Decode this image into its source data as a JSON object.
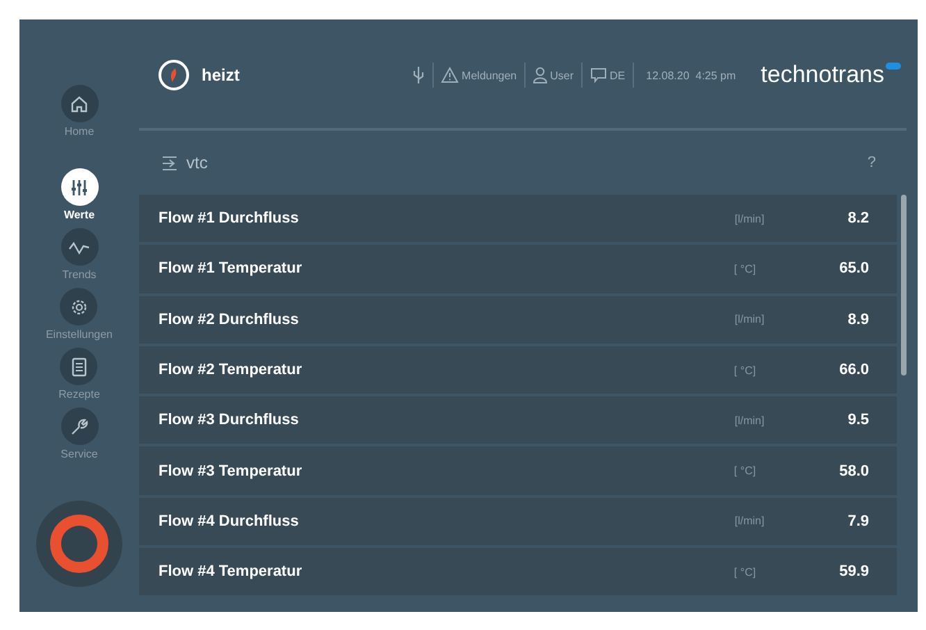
{
  "sidebar": {
    "items": [
      {
        "label": "Home",
        "selected": false
      },
      {
        "label": "Werte",
        "selected": true
      },
      {
        "label": "Trends",
        "selected": false
      },
      {
        "label": "Einstellungen",
        "selected": false
      },
      {
        "label": "Rezepte",
        "selected": false
      },
      {
        "label": "Service",
        "selected": false
      }
    ]
  },
  "header": {
    "status": "heizt",
    "messages": "Meldungen",
    "user": "User",
    "language": "DE",
    "datetime": "12.08.20  4:25 pm",
    "brand": "technotrans"
  },
  "breadcrumb": {
    "label": "vtc",
    "help": "?"
  },
  "rows": [
    {
      "name": "Flow #1 Durchfluss",
      "unit": "[l/min]",
      "value": "8.2"
    },
    {
      "name": "Flow #1 Temperatur",
      "unit": "[ °C]",
      "value": "65.0"
    },
    {
      "name": "Flow #2 Durchfluss",
      "unit": "[l/min]",
      "value": "8.9"
    },
    {
      "name": "Flow #2 Temperatur",
      "unit": "[ °C]",
      "value": "66.0"
    },
    {
      "name": "Flow #3 Durchfluss",
      "unit": "[l/min]",
      "value": "9.5"
    },
    {
      "name": "Flow #3 Temperatur",
      "unit": "[ °C]",
      "value": "58.0"
    },
    {
      "name": "Flow #4 Durchfluss",
      "unit": "[l/min]",
      "value": "7.9"
    },
    {
      "name": "Flow #4 Temperatur",
      "unit": "[ °C]",
      "value": "59.9"
    }
  ]
}
